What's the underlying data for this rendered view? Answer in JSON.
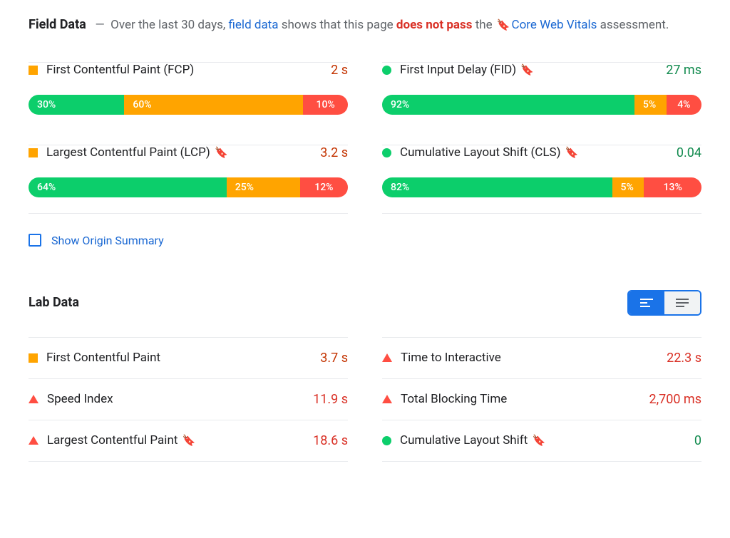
{
  "intro": {
    "title": "Field Data",
    "sep": "—",
    "text1": "Over the last 30 days,",
    "link1": "field data",
    "text2": "shows that this page",
    "fail": "does not pass",
    "text3": "the",
    "link2": "Core Web Vitals",
    "text4": "assessment."
  },
  "field": {
    "left": [
      {
        "shape": "sq-orange",
        "label": "First Contentful Paint (FCP)",
        "bookmark": false,
        "value": "2 s",
        "vclass": "v-orange",
        "dist": {
          "g": "30%",
          "o": "60%",
          "r": "10%",
          "gw": 30,
          "ow": 56,
          "rw": 14
        }
      },
      {
        "shape": "sq-orange",
        "label": "Largest Contentful Paint (LCP)",
        "bookmark": true,
        "value": "3.2 s",
        "vclass": "v-orange",
        "dist": {
          "g": "64%",
          "o": "25%",
          "r": "12%",
          "gw": 62,
          "ow": 23,
          "rw": 15
        }
      }
    ],
    "right": [
      {
        "shape": "sq-green",
        "label": "First Input Delay (FID)",
        "bookmark": true,
        "value": "27 ms",
        "vclass": "v-green",
        "dist": {
          "g": "92%",
          "o": "5%",
          "r": "4%",
          "gw": 79,
          "ow": 10,
          "rw": 11
        }
      },
      {
        "shape": "sq-green",
        "label": "Cumulative Layout Shift (CLS)",
        "bookmark": true,
        "value": "0.04",
        "vclass": "v-green",
        "dist": {
          "g": "82%",
          "o": "5%",
          "r": "13%",
          "gw": 72,
          "ow": 10,
          "rw": 18
        }
      }
    ]
  },
  "origin_label": "Show Origin Summary",
  "lab": {
    "title": "Lab Data",
    "left": [
      {
        "shape": "sq-orange",
        "label": "First Contentful Paint",
        "bookmark": false,
        "value": "3.7 s",
        "vclass": "v-orange"
      },
      {
        "shape": "tri-red",
        "label": "Speed Index",
        "bookmark": false,
        "value": "11.9 s",
        "vclass": "v-red"
      },
      {
        "shape": "tri-red",
        "label": "Largest Contentful Paint",
        "bookmark": true,
        "value": "18.6 s",
        "vclass": "v-red"
      }
    ],
    "right": [
      {
        "shape": "tri-red",
        "label": "Time to Interactive",
        "bookmark": false,
        "value": "22.3 s",
        "vclass": "v-red"
      },
      {
        "shape": "tri-red",
        "label": "Total Blocking Time",
        "bookmark": false,
        "value": "2,700 ms",
        "vclass": "v-red"
      },
      {
        "shape": "sq-green",
        "label": "Cumulative Layout Shift",
        "bookmark": true,
        "value": "0",
        "vclass": "v-green"
      }
    ]
  }
}
